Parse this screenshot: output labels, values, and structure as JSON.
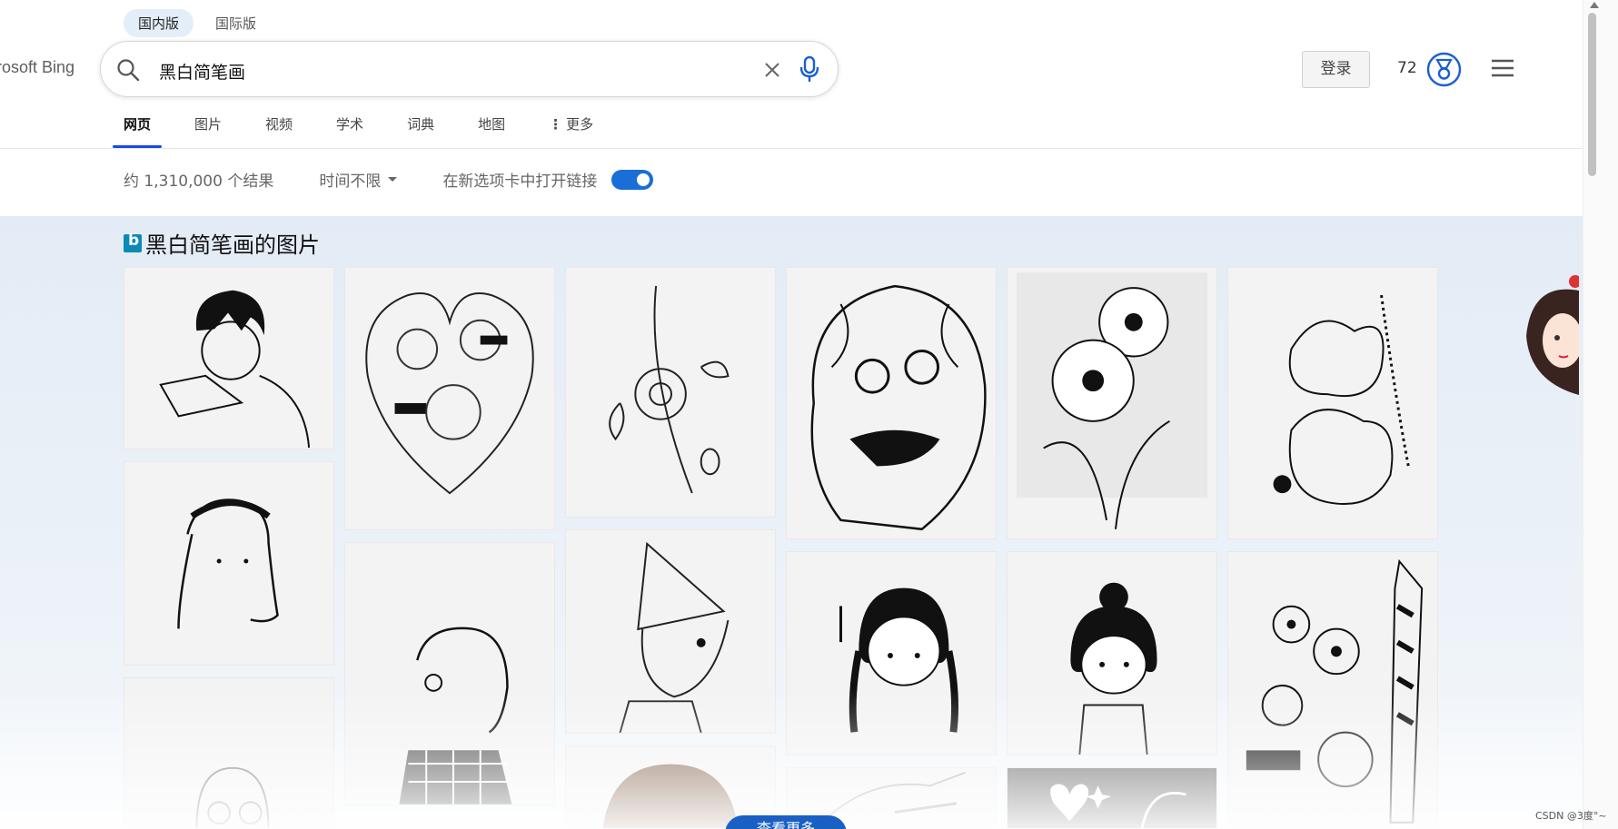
{
  "market": {
    "domestic": "国内版",
    "international": "国际版"
  },
  "brand": "rosoft Bing",
  "search": {
    "query": "黑白简笔画"
  },
  "header": {
    "login_label": "登录",
    "points": "72"
  },
  "tabs": [
    {
      "label": "网页",
      "active": true
    },
    {
      "label": "图片"
    },
    {
      "label": "视频"
    },
    {
      "label": "学术"
    },
    {
      "label": "词典"
    },
    {
      "label": "地图"
    },
    {
      "label": "更多"
    }
  ],
  "toolbar": {
    "result_count": "约 1,310,000 个结果",
    "time_filter": "时间不限",
    "new_tab_label": "在新选项卡中打开链接",
    "new_tab_enabled": true
  },
  "images_section": {
    "title": "黑白简笔画的图片",
    "more_label": "查看更多"
  },
  "watermark": "CSDN @3度°~",
  "colors": {
    "accent": "#174ae4",
    "toggle": "#1a6ed8",
    "section_bg": "#e3ecf6",
    "logo": "#0b8ab5"
  }
}
